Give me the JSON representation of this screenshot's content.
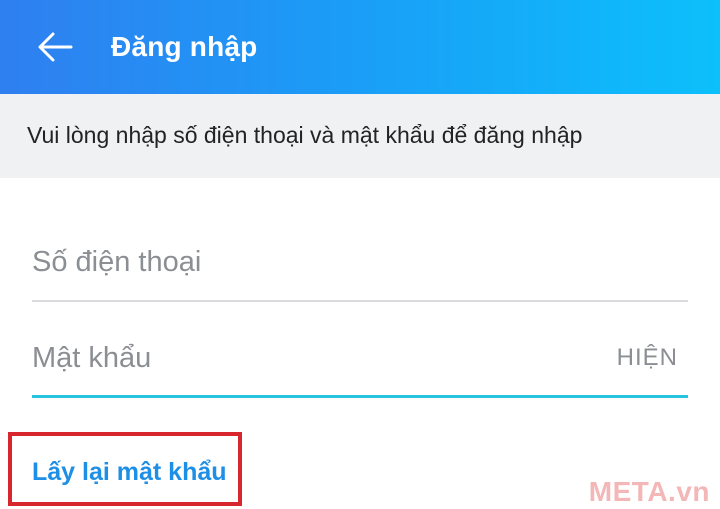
{
  "header": {
    "title": "Đăng nhập",
    "back_icon": "arrow-left-icon",
    "gradient": [
      "#2f7ff0",
      "#0cc0fb"
    ]
  },
  "instruction": {
    "text": "Vui lòng nhập số điện thoại và mật khẩu để đăng nhập"
  },
  "form": {
    "phone": {
      "value": "",
      "placeholder": "Số điện thoại"
    },
    "password": {
      "value": "",
      "placeholder": "Mật khẩu",
      "show_label": "HIỆN",
      "focus_color": "#27c3df"
    },
    "recover_label": "Lấy lại mật khẩu",
    "link_color": "#1e8fe6",
    "highlight_color": "#d8262e"
  },
  "watermark": {
    "text": "META.vn"
  }
}
